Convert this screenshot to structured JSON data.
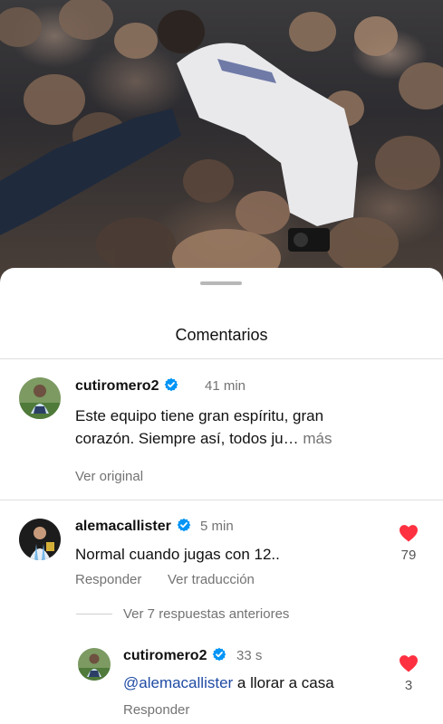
{
  "sheet": {
    "title": "Comentarios"
  },
  "post_comment": {
    "username": "cutiromero2",
    "time": "41 min",
    "text": "Este equipo tiene gran espíritu, gran",
    "text_line2": "corazón. Siempre así, todos ju…",
    "more_label": "más",
    "see_original_label": "Ver original"
  },
  "comment": {
    "username": "alemacallister",
    "time": "5 min",
    "text": "Normal cuando jugas con 12..",
    "reply_label": "Responder",
    "translate_label": "Ver traducción",
    "likes": "79"
  },
  "replies_toggle": {
    "label": "Ver 7 respuestas anteriores"
  },
  "reply": {
    "username": "cutiromero2",
    "time": "33 s",
    "mention": "@alemacallister",
    "text": " a llorar a casa",
    "reply_label": "Responder",
    "likes": "3"
  },
  "colors": {
    "verified": "#0095f6",
    "heart": "#ff3040",
    "mention": "#1f4ba5"
  },
  "icons": {
    "verified": "verified-badge-icon",
    "like": "heart-filled-icon"
  }
}
